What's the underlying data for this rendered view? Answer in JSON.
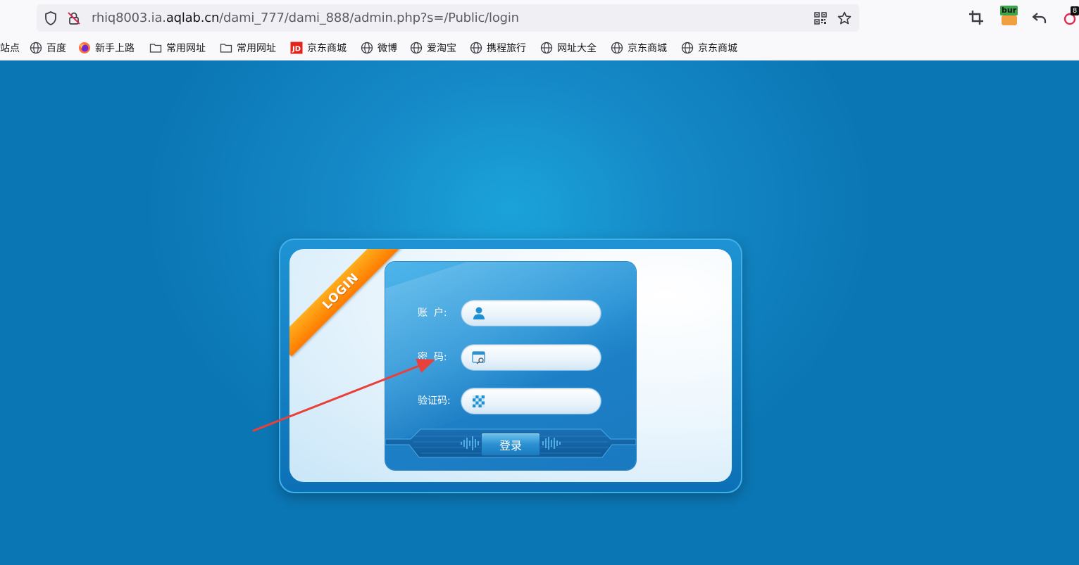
{
  "browser": {
    "url_prefix": "rhiq8003.ia.",
    "url_host": "aqlab.cn",
    "url_path": "/dami_777/dami_888/admin.php?s=/Public/login",
    "extension_badge": "bur",
    "notification_count": "8"
  },
  "bookmarks": [
    {
      "label": "站点",
      "icon": "partial"
    },
    {
      "label": "百度",
      "icon": "globe-icon"
    },
    {
      "label": "新手上路",
      "icon": "firefox-icon"
    },
    {
      "label": "常用网址",
      "icon": "folder-icon"
    },
    {
      "label": "常用网址",
      "icon": "folder-icon"
    },
    {
      "label": "京东商城",
      "icon": "jd-icon"
    },
    {
      "label": "微博",
      "icon": "globe-icon"
    },
    {
      "label": "爱淘宝",
      "icon": "globe-icon"
    },
    {
      "label": "携程旅行",
      "icon": "globe-icon"
    },
    {
      "label": "网址大全",
      "icon": "globe-icon"
    },
    {
      "label": "京东商城",
      "icon": "globe-icon"
    },
    {
      "label": "京东商城",
      "icon": "globe-icon"
    }
  ],
  "login": {
    "ribbon": "LOGIN",
    "account_label": "账  户:",
    "password_label": "密  码:",
    "captcha_label": "验证码:",
    "account_value": "",
    "password_value": "",
    "captcha_value": "",
    "submit_label": "登录"
  },
  "colors": {
    "page_bg": "#0b76b4",
    "ribbon": "#ff8a00",
    "annotation_arrow": "#e8413c"
  }
}
